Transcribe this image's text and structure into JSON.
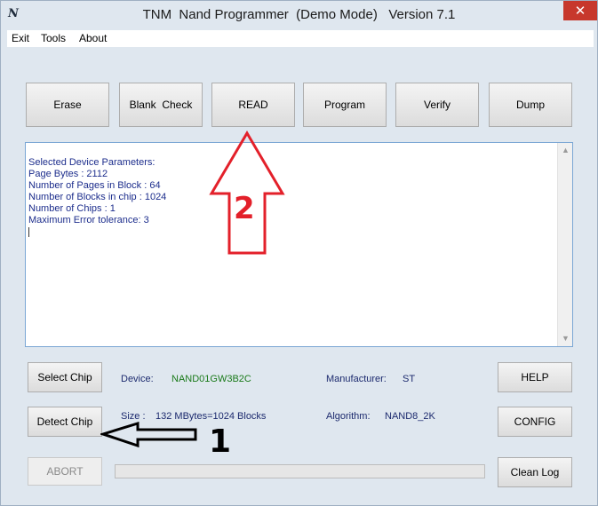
{
  "window": {
    "title": "TNM  Nand Programmer  (Demo Mode)   Version 7.1",
    "app_icon_glyph": "N",
    "close_glyph": "✕"
  },
  "menu": {
    "items": [
      "Exit",
      "Tools",
      "About"
    ]
  },
  "toolbar": {
    "erase": "Erase",
    "blank_check": "Blank  Check",
    "read": "READ",
    "program": "Program",
    "verify": "Verify",
    "dump": "Dump"
  },
  "log": {
    "lines": [
      "Selected Device Parameters:",
      "Page Bytes : 2112",
      "Number of Pages in Block : 64",
      "Number of Blocks in chip : 1024",
      "Number of Chips : 1",
      "Maximum Error tolerance: 3"
    ]
  },
  "chip": {
    "select_button": "Select Chip",
    "detect_button": "Detect Chip",
    "device_label": "Device:",
    "device_value": "NAND01GW3B2C",
    "manufacturer_label": "Manufacturer:",
    "manufacturer_value": "ST",
    "size_label": "Size :",
    "size_value": "132 MBytes=1024 Blocks",
    "algorithm_label": "Algorithm:",
    "algorithm_value": "NAND8_2K"
  },
  "side": {
    "help": "HELP",
    "config": "CONFIG",
    "clean_log": "Clean Log"
  },
  "bottom": {
    "abort": "ABORT",
    "progress_fraction": 0
  },
  "annotations": {
    "arrow_1_label": "1",
    "arrow_2_label": "2"
  },
  "colors": {
    "annotation_red": "#e3202a",
    "annotation_black": "#000000",
    "log_text": "#1c2d8c",
    "device_value": "#1a7a1a",
    "close_button": "#c7382c"
  }
}
